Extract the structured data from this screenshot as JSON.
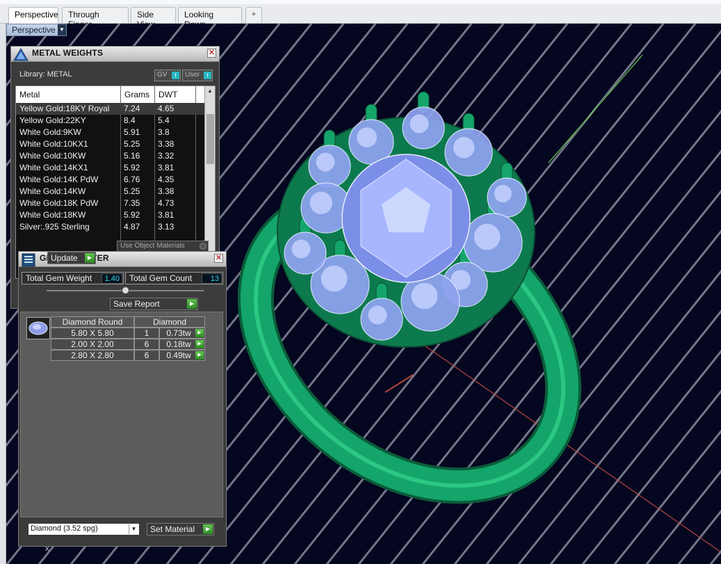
{
  "tabs": [
    {
      "label": "Perspective",
      "active": true
    },
    {
      "label": "Through Finger",
      "active": false
    },
    {
      "label": "Side View",
      "active": false
    },
    {
      "label": "Looking Down",
      "active": false
    }
  ],
  "add_tab_symbol": "+",
  "viewport": {
    "view_label": "Perspective",
    "background": "#050620",
    "model": "cluster ring with round diamonds"
  },
  "metal_weights": {
    "title": "METAL WEIGHTS",
    "library_label": "Library: METAL",
    "gv_label": "GV",
    "user_label": "User",
    "columns": [
      "Metal",
      "Grams",
      "DWT"
    ],
    "rows": [
      {
        "metal": "Yellow Gold:18KY Royal",
        "grams": "7.24",
        "dwt": "4.65"
      },
      {
        "metal": "Yellow Gold:22KY",
        "grams": "8.4",
        "dwt": "5.4"
      },
      {
        "metal": "White Gold:9KW",
        "grams": "5.91",
        "dwt": "3.8"
      },
      {
        "metal": "White Gold:10KX1",
        "grams": "5.25",
        "dwt": "3.38"
      },
      {
        "metal": "White Gold:10KW",
        "grams": "5.16",
        "dwt": "3.32"
      },
      {
        "metal": "White Gold:14KX1",
        "grams": "5.92",
        "dwt": "3.81"
      },
      {
        "metal": "White Gold:14K PdW",
        "grams": "6.76",
        "dwt": "4.35"
      },
      {
        "metal": "White Gold:14KW",
        "grams": "5.25",
        "dwt": "3.38"
      },
      {
        "metal": "White Gold:18K PdW",
        "grams": "7.35",
        "dwt": "4.73"
      },
      {
        "metal": "White Gold:18KW",
        "grams": "5.92",
        "dwt": "3.81"
      },
      {
        "metal": "Silver:.925 Sterling",
        "grams": "4.87",
        "dwt": "3.13"
      }
    ],
    "use_object_materials": "Use Object Materials"
  },
  "gem_reporter": {
    "title": "GEM REPORTER",
    "total_weight_label": "Total Gem Weight",
    "total_weight_value": "1.40",
    "total_count_label": "Total Gem Count",
    "total_count_value": "13",
    "update_label": "Update",
    "save_report_label": "Save Report",
    "table_header": [
      "Diamond Round",
      "Diamond"
    ],
    "gems": [
      {
        "size": "5.80 X 5.80",
        "count": "1",
        "weight": "0.73tw"
      },
      {
        "size": "2.00 X 2.00",
        "count": "6",
        "weight": "0.18tw"
      },
      {
        "size": "2.80 X 2.80",
        "count": "6",
        "weight": "0.49tw"
      }
    ],
    "material_select": "Diamond    (3.52 spg)",
    "set_material_label": "Set Material"
  },
  "colors": {
    "accent": "#27b8c2",
    "go_green": "#3aa52f",
    "metal_green": "#14a56a",
    "gem_blue": "#8fa3f0"
  }
}
